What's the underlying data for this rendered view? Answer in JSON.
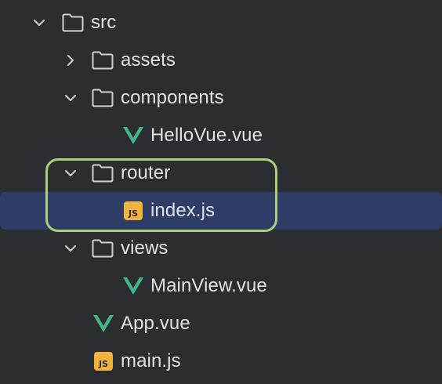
{
  "tree": {
    "src": "src",
    "assets": "assets",
    "components": "components",
    "hello_vue": "HelloVue.vue",
    "router": "router",
    "index_js": "index.js",
    "views": "views",
    "main_view": "MainView.vue",
    "app_vue": "App.vue",
    "main_js": "main.js"
  },
  "icons": {
    "js_badge_text": "JS",
    "folder": "folder-icon",
    "vue": "vue-icon",
    "js": "js-file-icon"
  },
  "colors": {
    "background": "#2b2d30",
    "selection": "#2e3d66",
    "highlight_outline": "#a9cf7c",
    "vue_green": "#41b883",
    "js_yellow": "#f0b33e",
    "text": "#dfe1e5",
    "icon_stroke": "#ced0d6"
  },
  "state": {
    "selected_item": "index.js",
    "expanded": [
      "src",
      "components",
      "router",
      "views"
    ],
    "collapsed": [
      "assets"
    ]
  }
}
